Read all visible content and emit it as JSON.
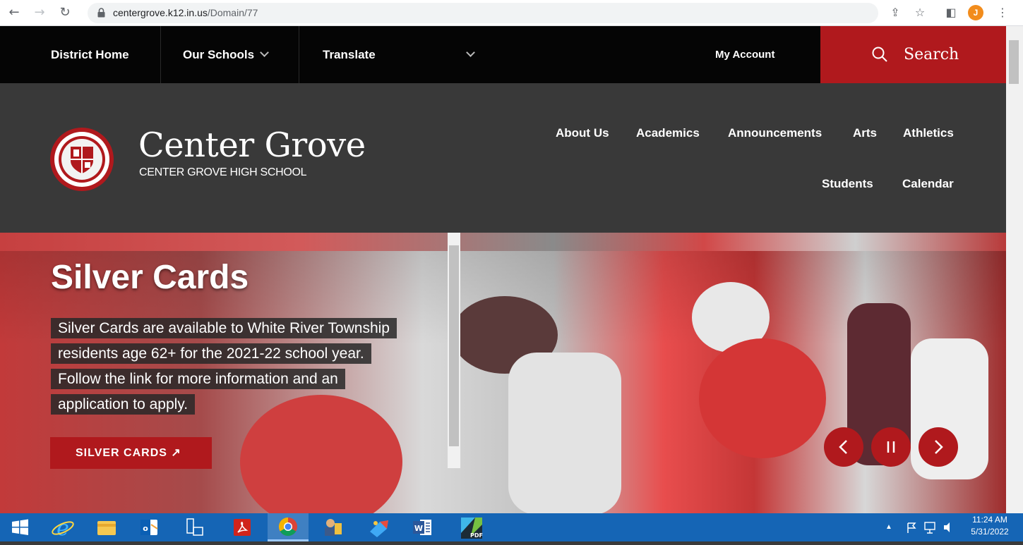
{
  "browser": {
    "url_host": "centergrove.k12.in.us",
    "url_path": "/Domain/77",
    "profile_initial": "J"
  },
  "topnav": {
    "district_home": "District Home",
    "our_schools": "Our Schools",
    "translate": "Translate",
    "my_account": "My Account",
    "search": "Search"
  },
  "header": {
    "brand": "Center Grove",
    "subtitle": "CENTER GROVE HIGH SCHOOL",
    "nav": [
      "About Us",
      "Academics",
      "Announcements",
      "Arts",
      "Athletics",
      "Students",
      "Calendar"
    ]
  },
  "hero": {
    "title": "Silver Cards",
    "description": "Silver Cards are available to White River Township residents age 62+ for the 2021-22 school year. Follow the link for more information and an application to apply.",
    "button": "SILVER CARDS",
    "accent_color": "#b0191d"
  },
  "taskbar": {
    "time": "11:24 AM",
    "date": "5/31/2022",
    "apps": [
      "start-icon",
      "internet-explorer-icon",
      "file-explorer-icon",
      "outlook-icon",
      "network-icon",
      "acrobat-icon",
      "chrome-icon",
      "app-icon",
      "app-icon",
      "word-icon",
      "pdf-icon"
    ]
  }
}
